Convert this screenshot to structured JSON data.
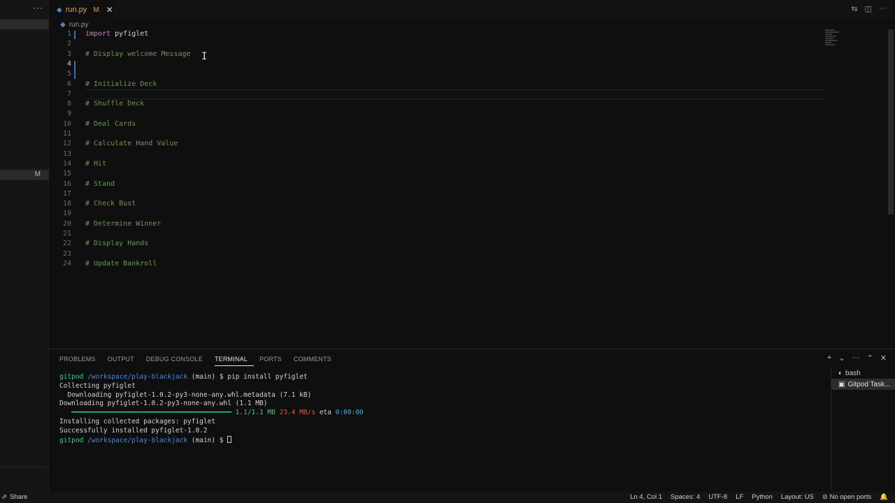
{
  "tab": {
    "filename": "run.py",
    "modified": "M",
    "close": "✕"
  },
  "breadcrumb": {
    "file": "run.py"
  },
  "sidebar": {
    "more": "···",
    "modified_badge": "M"
  },
  "editor": {
    "lines": [
      {
        "n": "1",
        "kw": "import",
        "ident": " pyfiglet",
        "cmt": ""
      },
      {
        "n": "2",
        "kw": "",
        "ident": "",
        "cmt": ""
      },
      {
        "n": "3",
        "kw": "",
        "ident": "",
        "cmt": "# Display welcome Message"
      },
      {
        "n": "4",
        "kw": "",
        "ident": "",
        "cmt": ""
      },
      {
        "n": "5",
        "kw": "",
        "ident": "",
        "cmt": ""
      },
      {
        "n": "6",
        "kw": "",
        "ident": "",
        "cmt": "# Initialize Deck"
      },
      {
        "n": "7",
        "kw": "",
        "ident": "",
        "cmt": ""
      },
      {
        "n": "8",
        "kw": "",
        "ident": "",
        "cmt": "# Shuffle Deck"
      },
      {
        "n": "9",
        "kw": "",
        "ident": "",
        "cmt": ""
      },
      {
        "n": "10",
        "kw": "",
        "ident": "",
        "cmt": "# Deal Cards"
      },
      {
        "n": "11",
        "kw": "",
        "ident": "",
        "cmt": ""
      },
      {
        "n": "12",
        "kw": "",
        "ident": "",
        "cmt": "# Calculate Hand Value"
      },
      {
        "n": "13",
        "kw": "",
        "ident": "",
        "cmt": ""
      },
      {
        "n": "14",
        "kw": "",
        "ident": "",
        "cmt": "# Hit"
      },
      {
        "n": "15",
        "kw": "",
        "ident": "",
        "cmt": ""
      },
      {
        "n": "16",
        "kw": "",
        "ident": "",
        "cmt": "# Stand"
      },
      {
        "n": "17",
        "kw": "",
        "ident": "",
        "cmt": ""
      },
      {
        "n": "18",
        "kw": "",
        "ident": "",
        "cmt": "# Check Bust"
      },
      {
        "n": "19",
        "kw": "",
        "ident": "",
        "cmt": ""
      },
      {
        "n": "20",
        "kw": "",
        "ident": "",
        "cmt": "# Determine Winner"
      },
      {
        "n": "21",
        "kw": "",
        "ident": "",
        "cmt": ""
      },
      {
        "n": "22",
        "kw": "",
        "ident": "",
        "cmt": "# Display Hands"
      },
      {
        "n": "23",
        "kw": "",
        "ident": "",
        "cmt": ""
      },
      {
        "n": "24",
        "kw": "",
        "ident": "",
        "cmt": "# Update Bankroll"
      }
    ]
  },
  "panel": {
    "tabs": [
      "PROBLEMS",
      "OUTPUT",
      "DEBUG CONSOLE",
      "TERMINAL",
      "PORTS",
      "COMMENTS"
    ],
    "active_tab": "TERMINAL",
    "terminals": [
      "bash",
      "Gitpod Task..."
    ]
  },
  "terminal": {
    "prompt_user": "gitpod",
    "prompt_path": "/workspace/play-blackjack",
    "prompt_branch": " (main) $ ",
    "cmd1": "pip install pyfiglet",
    "l2": "Collecting pyfiglet",
    "l3": "  Downloading pyfiglet-1.0.2-py3-none-any.whl.metadata (7.1 kB)",
    "l4": "Downloading pyfiglet-1.0.2-py3-none-any.whl (1.1 MB)",
    "progress_bar": "   ━━━━━━━━━━━━━━━━━━━━━━━━━━━━━━━━━━━━━━━━ ",
    "progress_size": "1.1/1.1 MB",
    "progress_speed": "23.4 MB/s",
    "progress_eta_label": "eta",
    "progress_eta": "0:00:00",
    "l6": "Installing collected packages: pyfiglet",
    "l7": "Successfully installed pyfiglet-1.0.2"
  },
  "statusbar": {
    "share": "Share",
    "position": "Ln 4, Col 1",
    "spaces": "Spaces: 4",
    "encoding": "UTF-8",
    "eol": "LF",
    "language": "Python",
    "layout": "Layout: US",
    "ports": "No open ports"
  },
  "colors": {
    "comment": "#6a9955",
    "keyword": "#c586c0",
    "prompt_green": "#23d18b",
    "prompt_blue": "#3b8eea"
  }
}
